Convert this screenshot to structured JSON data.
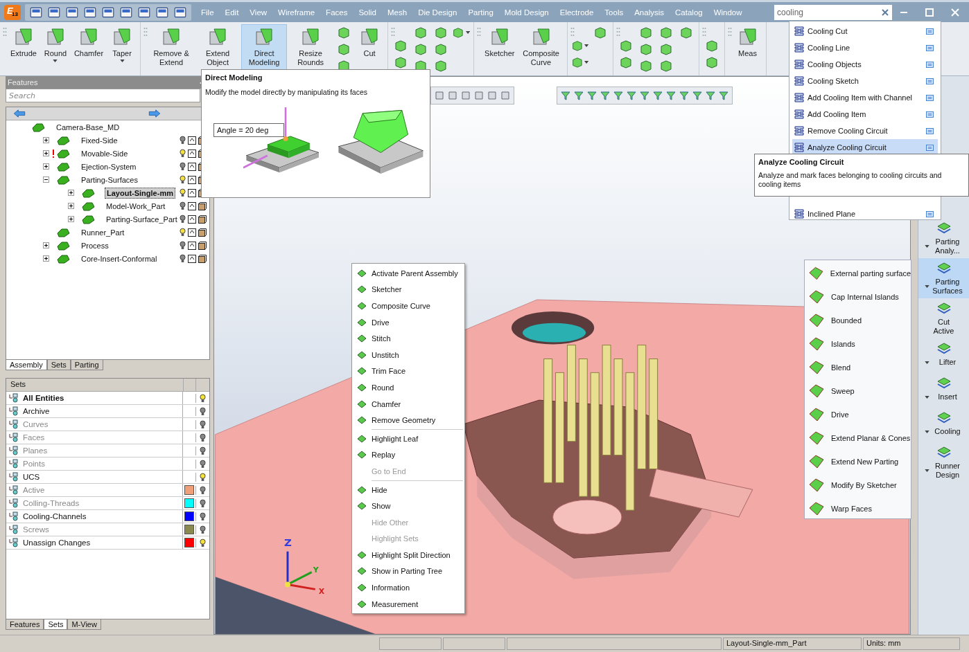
{
  "logo": {
    "letter": "E",
    "version": "13"
  },
  "menu": [
    "File",
    "Edit",
    "View",
    "Wireframe",
    "Faces",
    "Solid",
    "Mesh",
    "Die Design",
    "Parting",
    "Mold Design",
    "Electrode",
    "Tools",
    "Analysis",
    "Catalog",
    "Window"
  ],
  "search": {
    "value": "cooling",
    "results": [
      {
        "label": "Cooling Cut",
        "selected": false
      },
      {
        "label": "Cooling Line",
        "selected": false
      },
      {
        "label": "Cooling Objects",
        "selected": false
      },
      {
        "label": "Cooling Sketch",
        "selected": false
      },
      {
        "label": "Add Cooling Item with Channel",
        "selected": false
      },
      {
        "label": "Add Cooling Item",
        "selected": false
      },
      {
        "label": "Remove Cooling Circuit",
        "selected": false
      },
      {
        "label": "Analyze Cooling Circuit",
        "selected": true
      },
      {
        "label": "Inclined Plane",
        "selected": false
      }
    ],
    "tooltip": {
      "title": "Analyze Cooling Circuit",
      "text": "Analyze and mark faces belonging to cooling circuits and cooling items"
    }
  },
  "ribbon": {
    "groups": [
      {
        "buttons": [
          {
            "kind": "large",
            "label": "Extrude",
            "selected": false,
            "dropdown": false
          },
          {
            "kind": "large",
            "label": "Round",
            "selected": false,
            "dropdown": true
          },
          {
            "kind": "large",
            "label": "Chamfer",
            "selected": false,
            "dropdown": false
          },
          {
            "kind": "large",
            "label": "Taper",
            "selected": false,
            "dropdown": true
          }
        ]
      },
      {
        "buttons": [
          {
            "kind": "large",
            "label": "Remove & Extend",
            "selected": false,
            "dropdown": false
          },
          {
            "kind": "large",
            "label": "Extend Object",
            "selected": false,
            "dropdown": false
          },
          {
            "kind": "large",
            "label": "Direct Modeling",
            "selected": true,
            "dropdown": false
          },
          {
            "kind": "large",
            "label": "Resize Rounds",
            "selected": false,
            "dropdown": false
          },
          {
            "kind": "small",
            "selected": false,
            "dropdown": false
          },
          {
            "kind": "small",
            "selected": false,
            "dropdown": false
          },
          {
            "kind": "small",
            "selected": false,
            "dropdown": false
          },
          {
            "kind": "large",
            "label": "Cut",
            "selected": false,
            "dropdown": false
          }
        ]
      },
      {
        "buttons": [
          {
            "kind": "small",
            "selected": false,
            "dropdown": false
          },
          {
            "kind": "small",
            "selected": false,
            "dropdown": false
          },
          {
            "kind": "small",
            "selected": false,
            "dropdown": false
          },
          {
            "kind": "small",
            "selected": false,
            "dropdown": false
          },
          {
            "kind": "small",
            "selected": false,
            "dropdown": false
          },
          {
            "kind": "small",
            "selected": false,
            "dropdown": false
          },
          {
            "kind": "small",
            "selected": false,
            "dropdown": false
          },
          {
            "kind": "small",
            "selected": false,
            "dropdown": false
          },
          {
            "kind": "small",
            "selected": false,
            "dropdown": true
          }
        ]
      },
      {
        "buttons": [
          {
            "kind": "large",
            "label": "Sketcher",
            "selected": false,
            "dropdown": false
          },
          {
            "kind": "large",
            "label": "Composite Curve",
            "selected": false,
            "dropdown": false
          }
        ]
      },
      {
        "buttons": [
          {
            "kind": "small",
            "selected": false,
            "dropdown": true
          },
          {
            "kind": "small",
            "selected": false,
            "dropdown": true
          },
          {
            "kind": "small",
            "selected": false,
            "dropdown": false
          }
        ]
      },
      {
        "buttons": [
          {
            "kind": "small",
            "selected": false,
            "dropdown": false
          },
          {
            "kind": "small",
            "selected": false,
            "dropdown": false
          },
          {
            "kind": "small",
            "selected": false,
            "dropdown": false
          },
          {
            "kind": "small",
            "selected": false,
            "dropdown": false
          },
          {
            "kind": "small",
            "selected": false,
            "dropdown": false
          },
          {
            "kind": "small",
            "selected": false,
            "dropdown": false
          },
          {
            "kind": "small",
            "selected": false,
            "dropdown": false
          },
          {
            "kind": "small",
            "selected": false,
            "dropdown": false
          },
          {
            "kind": "small",
            "selected": false,
            "dropdown": false
          }
        ]
      },
      {
        "buttons": [
          {
            "kind": "small",
            "selected": false,
            "dropdown": false
          },
          {
            "kind": "small",
            "selected": false,
            "dropdown": false
          }
        ]
      },
      {
        "buttons": [
          {
            "kind": "large",
            "label": "Meas",
            "selected": false,
            "dropdown": false
          }
        ]
      }
    ]
  },
  "ribbon_tooltip": {
    "title": "Direct Modeling",
    "text": "Modify the model directly by manipulating its faces",
    "angle_label": "Angle = 20 deg"
  },
  "features_panel": {
    "title": "Features",
    "search_placeholder": "Search",
    "tree": {
      "items": [
        {
          "label": "Camera-Base_MD",
          "selected": false,
          "warning": false,
          "children": [
            {
              "label": "Fixed-Side",
              "expanded": false,
              "selected": false,
              "bulb_on": false,
              "warning": false
            },
            {
              "label": "Movable-Side",
              "expanded": false,
              "selected": false,
              "bulb_on": true,
              "warning": true
            },
            {
              "label": "Ejection-System",
              "expanded": false,
              "selected": false,
              "bulb_on": false,
              "warning": false
            },
            {
              "label": "Parting-Surfaces",
              "expanded": true,
              "selected": false,
              "bulb_on": true,
              "warning": false,
              "children": [
                {
                  "label": "Layout-Single-mm",
                  "expanded": false,
                  "selected": true,
                  "bulb_on": true,
                  "warning": false
                },
                {
                  "label": "Model-Work_Part",
                  "expanded": false,
                  "selected": false,
                  "bulb_on": false,
                  "warning": false
                },
                {
                  "label": "Parting-Surface_Part",
                  "expanded": false,
                  "selected": false,
                  "bulb_on": false,
                  "warning": false
                }
              ]
            },
            {
              "label": "Runner_Part",
              "selected": false,
              "bulb_on": true,
              "warning": false
            },
            {
              "label": "Process",
              "expanded": false,
              "selected": false,
              "bulb_on": false,
              "warning": false
            },
            {
              "label": "Core-Insert-Conformal",
              "expanded": false,
              "selected": false,
              "bulb_on": false,
              "warning": false
            }
          ]
        }
      ]
    },
    "tabs": [
      {
        "label": "Assembly",
        "selected": true
      },
      {
        "label": "Sets",
        "selected": false
      },
      {
        "label": "Parting",
        "selected": false
      }
    ]
  },
  "sets_panel": {
    "column": "Sets",
    "rows": [
      {
        "name": "All Entities",
        "bold": true,
        "dimmed": false,
        "bulb_on": true
      },
      {
        "name": "Archive",
        "bold": false,
        "dimmed": false,
        "bulb_on": false
      },
      {
        "name": "Curves",
        "bold": false,
        "dimmed": true,
        "bulb_on": false
      },
      {
        "name": "Faces",
        "bold": false,
        "dimmed": true,
        "bulb_on": false
      },
      {
        "name": "Planes",
        "bold": false,
        "dimmed": true,
        "bulb_on": false
      },
      {
        "name": "Points",
        "bold": false,
        "dimmed": true,
        "bulb_on": false
      },
      {
        "name": "UCS",
        "bold": false,
        "dimmed": false,
        "bulb_on": true
      },
      {
        "name": "Active",
        "bold": false,
        "dimmed": true,
        "bulb_on": false,
        "color": "#f0a078"
      },
      {
        "name": "Colling-Threads",
        "bold": false,
        "dimmed": true,
        "bulb_on": false,
        "color": "#00ffff"
      },
      {
        "name": "Cooling-Channels",
        "bold": false,
        "dimmed": false,
        "bulb_on": false,
        "color": "#0000ff"
      },
      {
        "name": "Screws",
        "bold": false,
        "dimmed": true,
        "bulb_on": false,
        "color": "#8a8a50"
      },
      {
        "name": "Unassign Changes",
        "bold": false,
        "dimmed": false,
        "bulb_on": true,
        "color": "#ff0000"
      }
    ],
    "tabs": [
      {
        "label": "Features",
        "selected": false
      },
      {
        "label": "Sets",
        "selected": true
      },
      {
        "label": "M-View",
        "selected": false
      }
    ]
  },
  "viewport": {
    "axis_labels": [
      "Z",
      "Y",
      "X"
    ]
  },
  "context_menu": [
    {
      "kind": "item",
      "label": "Activate Parent Assembly",
      "disabled": false
    },
    {
      "kind": "item",
      "label": "Sketcher",
      "disabled": false
    },
    {
      "kind": "item",
      "label": "Composite Curve",
      "disabled": false
    },
    {
      "kind": "item",
      "label": "Drive",
      "disabled": false
    },
    {
      "kind": "item",
      "label": "Stitch",
      "disabled": false
    },
    {
      "kind": "item",
      "label": "Unstitch",
      "disabled": false
    },
    {
      "kind": "item",
      "label": "Trim Face",
      "disabled": false
    },
    {
      "kind": "item",
      "label": "Round",
      "disabled": false
    },
    {
      "kind": "item",
      "label": "Chamfer",
      "disabled": false
    },
    {
      "kind": "item",
      "label": "Remove Geometry",
      "disabled": false
    },
    {
      "kind": "separator"
    },
    {
      "kind": "item",
      "label": "Highlight Leaf",
      "disabled": false
    },
    {
      "kind": "item",
      "label": "Replay",
      "disabled": false
    },
    {
      "kind": "item",
      "label": "Go to End",
      "disabled": true
    },
    {
      "kind": "separator"
    },
    {
      "kind": "item",
      "label": "Hide",
      "disabled": false
    },
    {
      "kind": "item",
      "label": "Show",
      "disabled": false
    },
    {
      "kind": "item",
      "label": "Hide Other",
      "disabled": true
    },
    {
      "kind": "item",
      "label": "Highlight Sets",
      "disabled": true
    },
    {
      "kind": "item",
      "label": "Highlight Split Direction",
      "disabled": false
    },
    {
      "kind": "item",
      "label": "Show in Parting Tree",
      "disabled": false
    },
    {
      "kind": "item",
      "label": "Information",
      "disabled": false
    },
    {
      "kind": "item",
      "label": "Measurement",
      "disabled": false
    }
  ],
  "flyout_menu": [
    "External parting surface",
    "Cap Internal Islands",
    "Bounded",
    "Islands",
    "Blend",
    "Sweep",
    "Drive",
    "Extend Planar & Cones",
    "Extend New Parting",
    "Modify By Sketcher",
    "Warp Faces"
  ],
  "right_toolbar": [
    {
      "label": "Parting Analy...",
      "dropdown": true,
      "selected": false
    },
    {
      "label": "Parting Surfaces",
      "dropdown": true,
      "selected": true
    },
    {
      "label": "Cut Active",
      "dropdown": false,
      "selected": false
    },
    {
      "label": "Lifter",
      "dropdown": true,
      "selected": false
    },
    {
      "label": "Insert",
      "dropdown": true,
      "selected": false
    },
    {
      "label": "Cooling",
      "dropdown": true,
      "selected": false
    },
    {
      "label": "Runner Design",
      "dropdown": true,
      "selected": false
    }
  ],
  "status_bar": [
    "Layout-Single-mm_Part",
    "Units: mm"
  ]
}
